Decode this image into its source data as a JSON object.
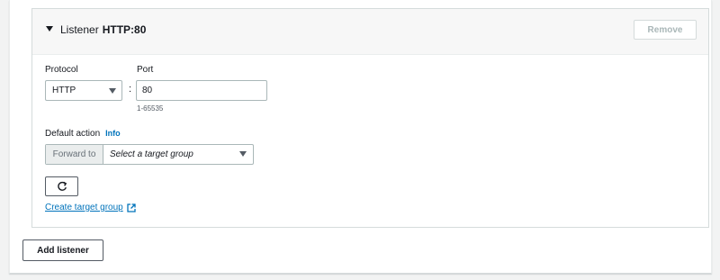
{
  "listener": {
    "title_prefix": "Listener",
    "title_value": "HTTP:80",
    "remove_label": "Remove"
  },
  "protocol": {
    "label": "Protocol",
    "selected": "HTTP"
  },
  "port": {
    "label": "Port",
    "value": "80",
    "hint": "1-65535",
    "separator": ":"
  },
  "default_action": {
    "label": "Default action",
    "info_label": "Info",
    "forward_to": "Forward to",
    "target_placeholder": "Select a target group"
  },
  "refresh": {
    "icon": "refresh-icon"
  },
  "create_target_group": {
    "label": "Create target group",
    "icon": "external-link-icon"
  },
  "add_listener_label": "Add listener",
  "colors": {
    "link": "#0073bb",
    "border": "#aab7b8",
    "disabled_text": "#aab7b8"
  }
}
